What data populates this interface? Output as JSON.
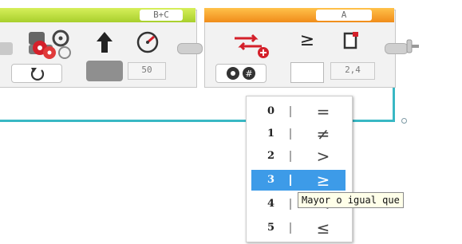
{
  "motor_block": {
    "port": "B+C",
    "mode_icon": "move-tank-icon",
    "params": [
      {
        "icon": "steering-arrow-icon"
      },
      {
        "icon": "speed-dial-icon",
        "value": "50"
      }
    ],
    "mode_selector_icon": "rotate-icon"
  },
  "compare_block": {
    "port": "A",
    "mode_icon": "compare-icon",
    "params": [
      {
        "icon": "comparison-selector-icon",
        "value": ">="
      },
      {
        "icon": "threshold-icon",
        "value": "2,4"
      }
    ],
    "mode_selector_icon": "gear-hash-icon"
  },
  "dropdown": {
    "selected_index": 3,
    "items": [
      {
        "num": "0",
        "symbol": "="
      },
      {
        "num": "1",
        "symbol": "≠"
      },
      {
        "num": "2",
        "symbol": ">"
      },
      {
        "num": "3",
        "symbol": "≥"
      },
      {
        "num": "4",
        "symbol": "<"
      },
      {
        "num": "5",
        "symbol": "≤"
      }
    ]
  },
  "tooltip": {
    "text": "Mayor o igual que"
  },
  "colors": {
    "wire_cyan": "#39b8c4",
    "wire_yellow": "#f2c230",
    "header_green": "#b6d834",
    "header_orange": "#f6a52c",
    "selected_blue": "#3d9be8"
  }
}
